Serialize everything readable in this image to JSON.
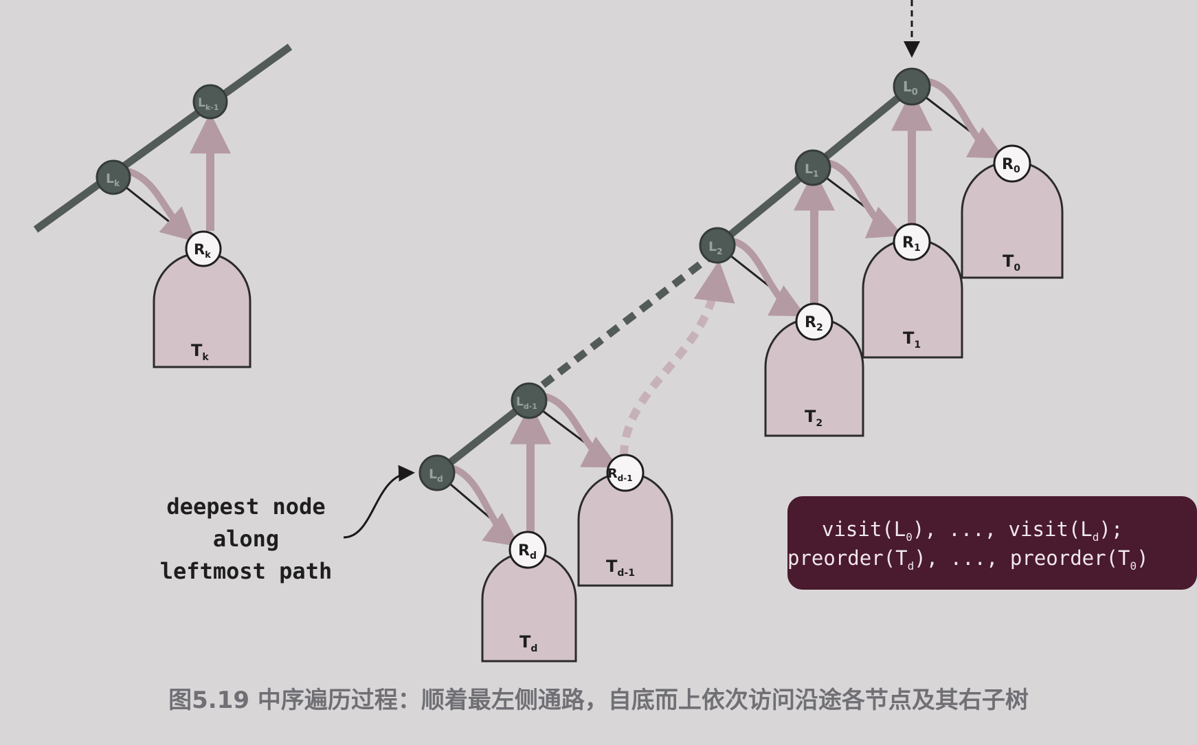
{
  "diagram": {
    "nodes": {
      "L_top": {
        "base": "L",
        "sub": "0"
      },
      "L_1": {
        "base": "L",
        "sub": "1"
      },
      "L_2": {
        "base": "L",
        "sub": "2"
      },
      "L_dm1": {
        "base": "L",
        "sub": "d-1"
      },
      "L_d": {
        "base": "L",
        "sub": "d"
      },
      "L_k": {
        "base": "L",
        "sub": "k"
      },
      "L_km1": {
        "base": "L",
        "sub": "k-1"
      },
      "R_top": {
        "base": "R",
        "sub": "0"
      },
      "R_1": {
        "base": "R",
        "sub": "1"
      },
      "R_2": {
        "base": "R",
        "sub": "2"
      },
      "R_dm1": {
        "base": "R",
        "sub": "d-1"
      },
      "R_d": {
        "base": "R",
        "sub": "d"
      },
      "R_k": {
        "base": "R",
        "sub": "k"
      }
    },
    "subtrees": {
      "T_top": {
        "base": "T",
        "sub": "0"
      },
      "T_1": {
        "base": "T",
        "sub": "1"
      },
      "T_2": {
        "base": "T",
        "sub": "2"
      },
      "T_dm1": {
        "base": "T",
        "sub": "d-1"
      },
      "T_d": {
        "base": "T",
        "sub": "d"
      },
      "T_k": {
        "base": "T",
        "sub": "k"
      }
    },
    "annotation": {
      "line1": "deepest node",
      "line2": "along",
      "line3": "leftmost path"
    },
    "code_box": {
      "line1": {
        "p1": "visit(L",
        "s1": "0",
        "p2": "), ..., visit(L",
        "s2": "d",
        "p3": ");"
      },
      "line2": {
        "p1": "preorder(T",
        "s1": "d",
        "p2": "), ..., preorder(T",
        "s2": "0",
        "p3": ")"
      }
    },
    "caption": "图5.19 中序遍历过程：顺着最左侧通路，自底而上依次访问沿途各节点及其右子树",
    "colors": {
      "background": "#d9d6d8",
      "left_node_fill": "#4f5a57",
      "left_path_line": "#535b59",
      "right_node_fill": "#f7f5f6",
      "subtree_fill": "#d3c2c8",
      "arrow_color": "#b49aa3",
      "code_box_bg": "#4a1a2e",
      "code_text": "#f0e8ec",
      "caption_color": "#6f6f74"
    }
  }
}
